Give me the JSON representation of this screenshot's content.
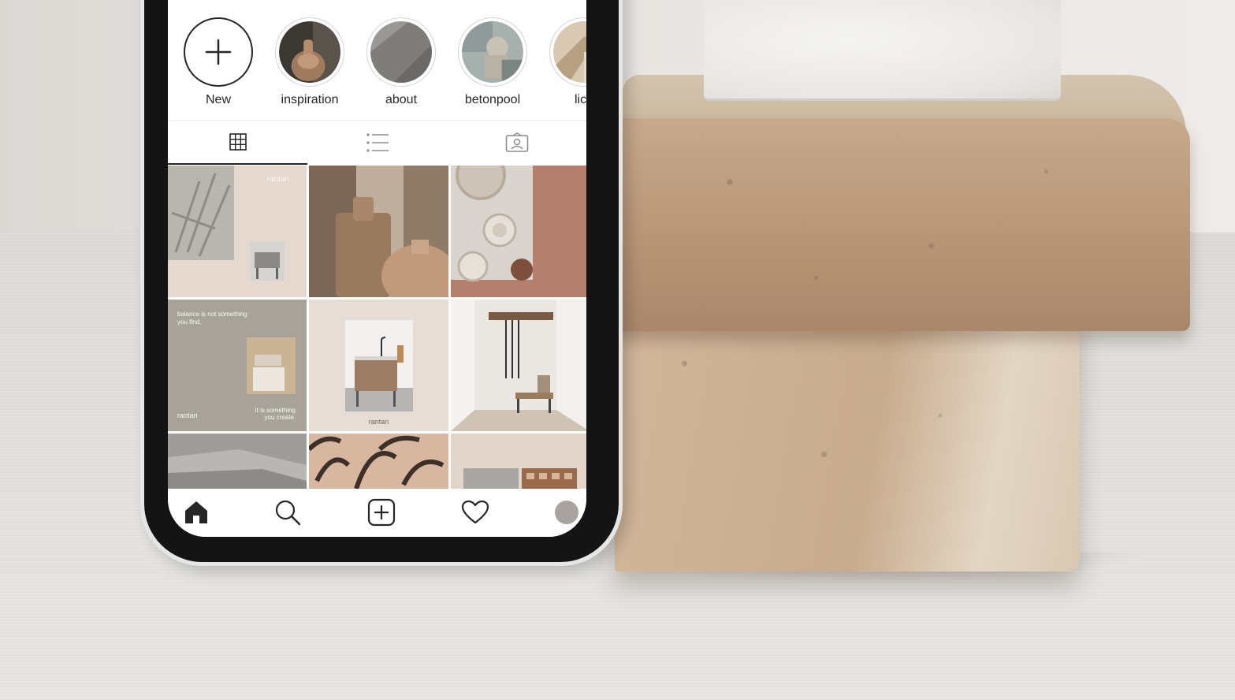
{
  "stories": [
    {
      "label": "New",
      "icon": "plus-icon"
    },
    {
      "label": "inspiration"
    },
    {
      "label": "about"
    },
    {
      "label": "betonpool"
    },
    {
      "label": "lich"
    }
  ],
  "tabs": [
    {
      "icon": "grid-icon",
      "active": true
    },
    {
      "icon": "list-icon",
      "active": false
    },
    {
      "icon": "tagged-icon",
      "active": false
    }
  ],
  "posts": {
    "tile1_brand": "rantan",
    "tile4_quote": "balance is not something you find,",
    "tile4_brand": "rantan",
    "tile4_quote2": "it is something you create.",
    "tile5_brand": "rantan"
  },
  "bottom_nav": [
    {
      "icon": "home-icon"
    },
    {
      "icon": "search-icon"
    },
    {
      "icon": "add-post-icon"
    },
    {
      "icon": "heart-icon"
    },
    {
      "icon": "profile-avatar"
    }
  ],
  "colors": {
    "ink": "#262626",
    "stone": "#b99677",
    "blush": "#b57f6d",
    "taupe": "#a8a398"
  }
}
